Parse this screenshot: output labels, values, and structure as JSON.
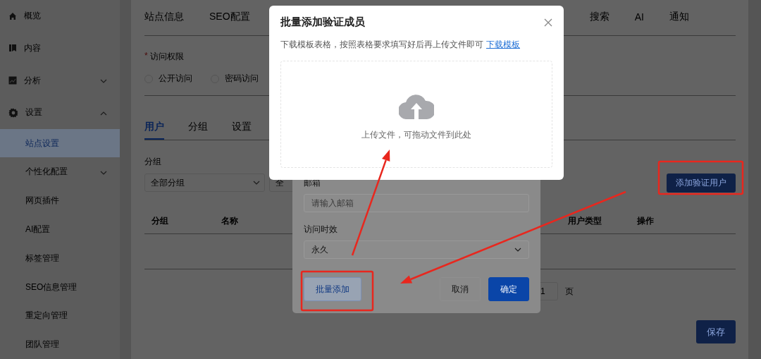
{
  "sidebar": {
    "items": [
      {
        "label": "概览",
        "kind": "link",
        "selected": false
      },
      {
        "label": "内容",
        "kind": "link",
        "selected": false
      },
      {
        "label": "分析",
        "kind": "group",
        "expanded": false,
        "selected": false
      },
      {
        "label": "设置",
        "kind": "group",
        "expanded": true,
        "selected": false,
        "children": [
          {
            "label": "站点设置",
            "kind": "link",
            "selected": true
          },
          {
            "label": "个性化配置",
            "kind": "group",
            "expanded": false,
            "selected": false
          },
          {
            "label": "网页插件",
            "kind": "link",
            "selected": false
          },
          {
            "label": "AI配置",
            "kind": "link",
            "selected": false
          },
          {
            "label": "标签管理",
            "kind": "link",
            "selected": false
          },
          {
            "label": "SEO信息管理",
            "kind": "link",
            "selected": false
          },
          {
            "label": "重定向管理",
            "kind": "link",
            "selected": false
          },
          {
            "label": "团队管理",
            "kind": "link",
            "selected": false
          }
        ]
      }
    ]
  },
  "main_tabs": [
    {
      "label": "站点信息",
      "selected": false
    },
    {
      "label": "SEO配置",
      "selected": false
    },
    {
      "label": "搜索",
      "selected": false
    },
    {
      "label": "AI",
      "selected": false
    },
    {
      "label": "通知",
      "selected": false
    }
  ],
  "access": {
    "label": "访问权限",
    "required_mark": "*",
    "options": [
      {
        "label": "公开访问",
        "selected": false
      },
      {
        "label": "密码访问",
        "selected": false
      }
    ]
  },
  "sub_tabs": [
    {
      "label": "用户",
      "selected": true
    },
    {
      "label": "分组",
      "selected": false
    },
    {
      "label": "设置",
      "selected": false
    }
  ],
  "filter": {
    "label": "分组",
    "selects": [
      {
        "value": "全部分组"
      },
      {
        "value": "全"
      }
    ]
  },
  "add_button": "添加验证用户",
  "table": {
    "columns": [
      "分组",
      "名称",
      "用户类型",
      "操作"
    ]
  },
  "pagination": {
    "page": "1",
    "suffix": "页"
  },
  "save_button": "保存",
  "member_dialog": {
    "fields": [
      {
        "kind": "input",
        "label": "邮箱",
        "placeholder": "请输入邮箱"
      },
      {
        "kind": "select",
        "label": "访问时效",
        "value": "永久"
      }
    ],
    "buttons": [
      {
        "kind": "batch",
        "label": "批量添加"
      },
      {
        "kind": "default",
        "label": "取消"
      },
      {
        "kind": "primary",
        "label": "确定"
      }
    ]
  },
  "upload_dialog": {
    "title": "批量添加验证成员",
    "description": "下载模板表格，按照表格要求填写好后再上传文件即可",
    "link": "下载模板",
    "upload_hint": "上传文件，可拖动文件到此处"
  }
}
